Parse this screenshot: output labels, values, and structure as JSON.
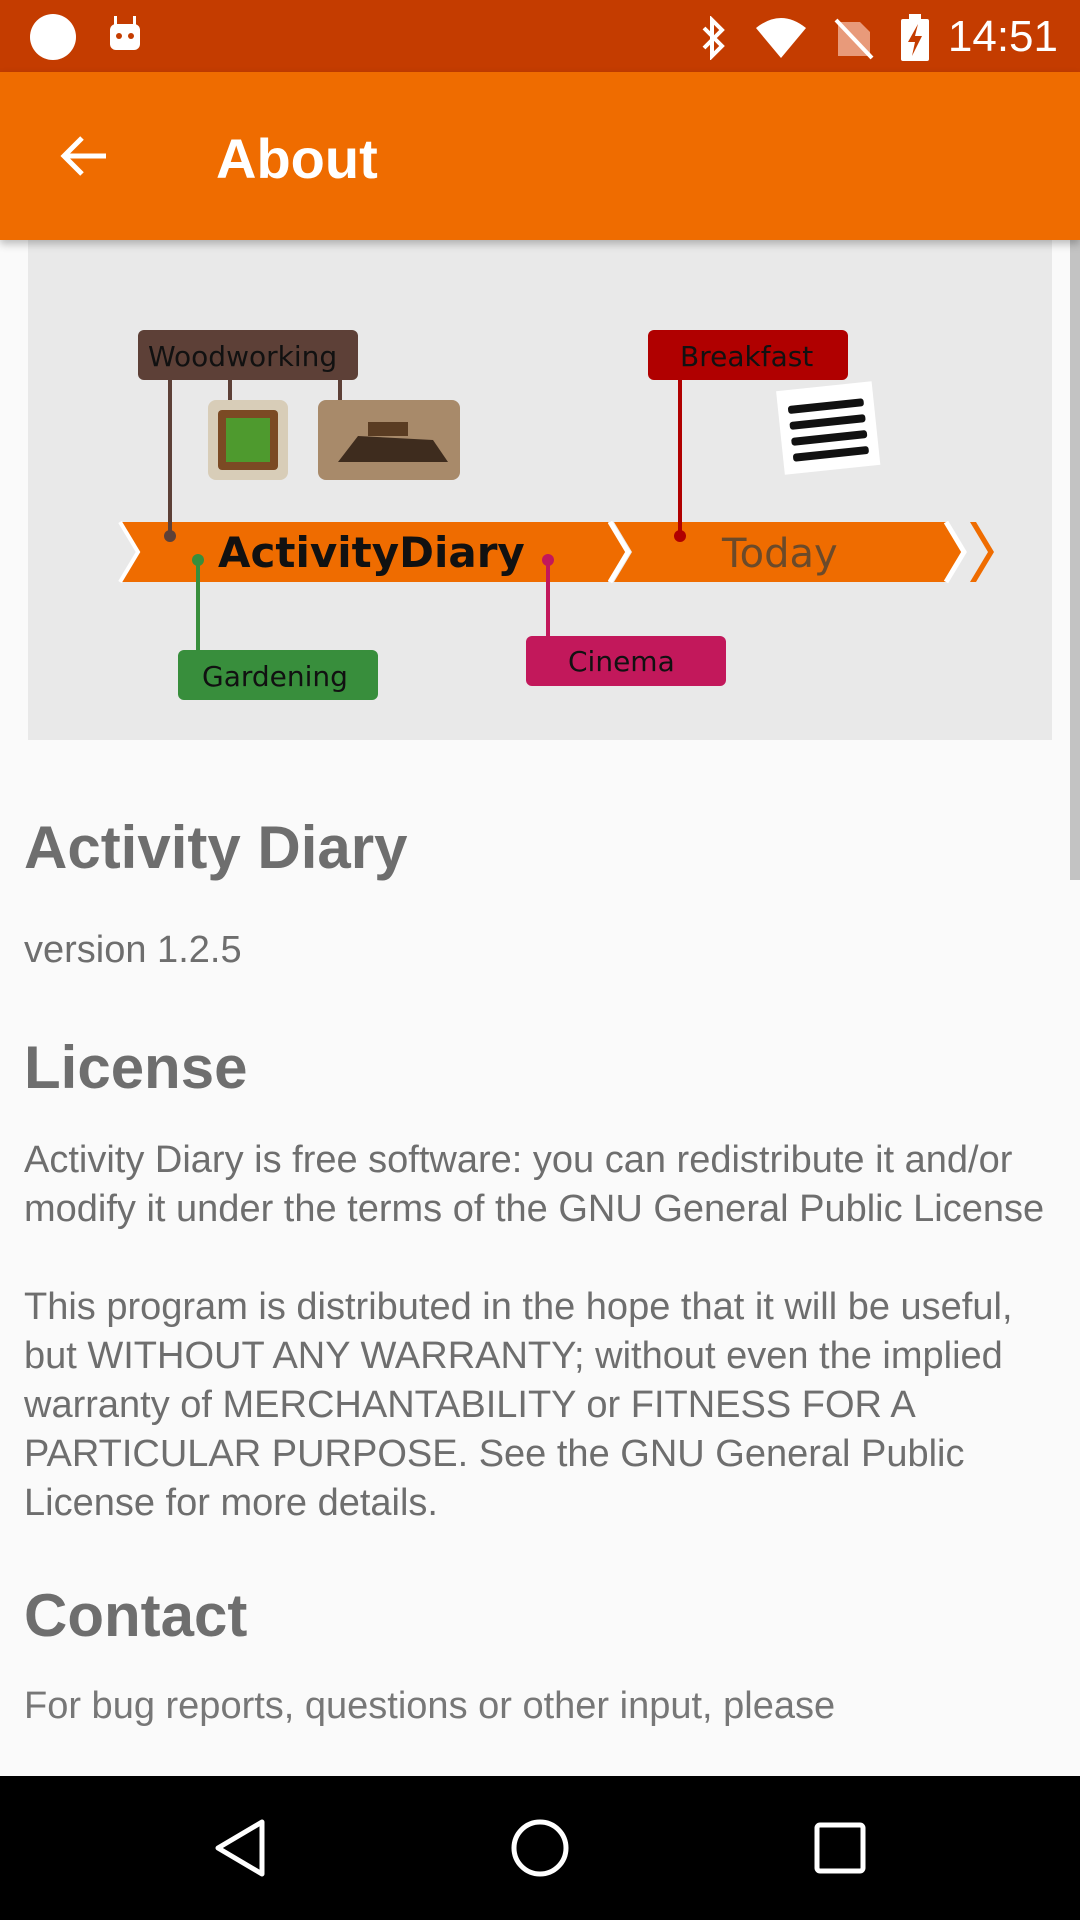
{
  "status_bar": {
    "time": "14:51",
    "icons": [
      "notification-dot-icon",
      "android-icon",
      "bluetooth-icon",
      "wifi-icon",
      "no-sim-icon",
      "battery-charging-icon"
    ]
  },
  "app_bar": {
    "title": "About",
    "back_icon": "arrow-back-icon",
    "color": "#ef6c00"
  },
  "banner": {
    "app_name": "ActivityDiary",
    "today_label": "Today",
    "activities": [
      {
        "label": "Woodworking",
        "color": "#5d4037"
      },
      {
        "label": "Breakfast",
        "color": "#b00000"
      },
      {
        "label": "Gardening",
        "color": "#388e3c"
      },
      {
        "label": "Cinema",
        "color": "#c2185b"
      }
    ],
    "timeline_color": "#ef6c00"
  },
  "about": {
    "app_title": "Activity Diary",
    "version": "version 1.2.5",
    "license_heading": "License",
    "license_text_1": "Activity Diary is free software: you can redistribute it and/or modify it under the terms of the GNU General Public License",
    "license_text_2": "This program is distributed in the hope that it will be useful, but WITHOUT ANY WARRANTY; without even the implied warranty of MERCHANTABILITY or FITNESS FOR A PARTICULAR PURPOSE. See the GNU General Public License for more details.",
    "contact_heading": "Contact",
    "contact_partial": "For bug reports, questions or other input, please"
  },
  "nav_bar": {
    "back_icon": "nav-back-icon",
    "home_icon": "nav-home-icon",
    "recents_icon": "nav-recents-icon"
  }
}
